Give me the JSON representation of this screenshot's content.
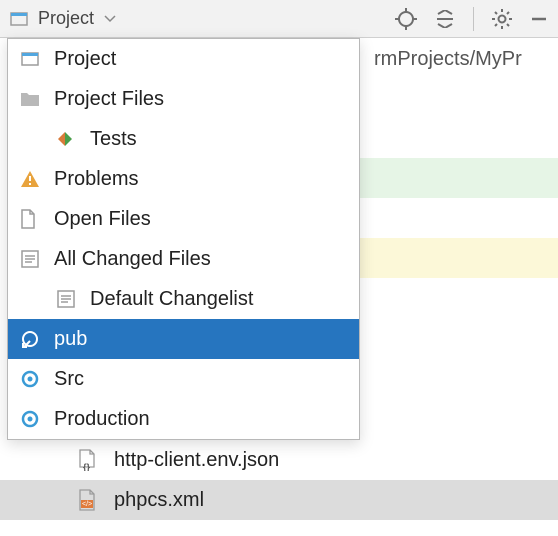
{
  "toolbar": {
    "view_label": "Project"
  },
  "breadcrumb_text": "rmProjects/MyPr",
  "dropdown": {
    "items": [
      {
        "label": "Project",
        "icon": "project-icon"
      },
      {
        "label": "Project Files",
        "icon": "folder-icon"
      },
      {
        "label": "Tests",
        "icon": "tests-icon",
        "indent": true
      },
      {
        "label": "Problems",
        "icon": "warning-icon"
      },
      {
        "label": "Open Files",
        "icon": "file-icon"
      },
      {
        "label": "All Changed Files",
        "icon": "changes-icon"
      },
      {
        "label": "Default Changelist",
        "icon": "changes-icon",
        "indent": true
      },
      {
        "label": "pub",
        "icon": "scope-share-icon",
        "selected": true
      },
      {
        "label": "Src",
        "icon": "scope-icon"
      },
      {
        "label": "Production",
        "icon": "scope-icon"
      }
    ]
  },
  "files": [
    {
      "name": "http-client.env.json",
      "icon": "json-icon"
    },
    {
      "name": "phpcs.xml",
      "icon": "xml-icon",
      "selected": true
    }
  ]
}
